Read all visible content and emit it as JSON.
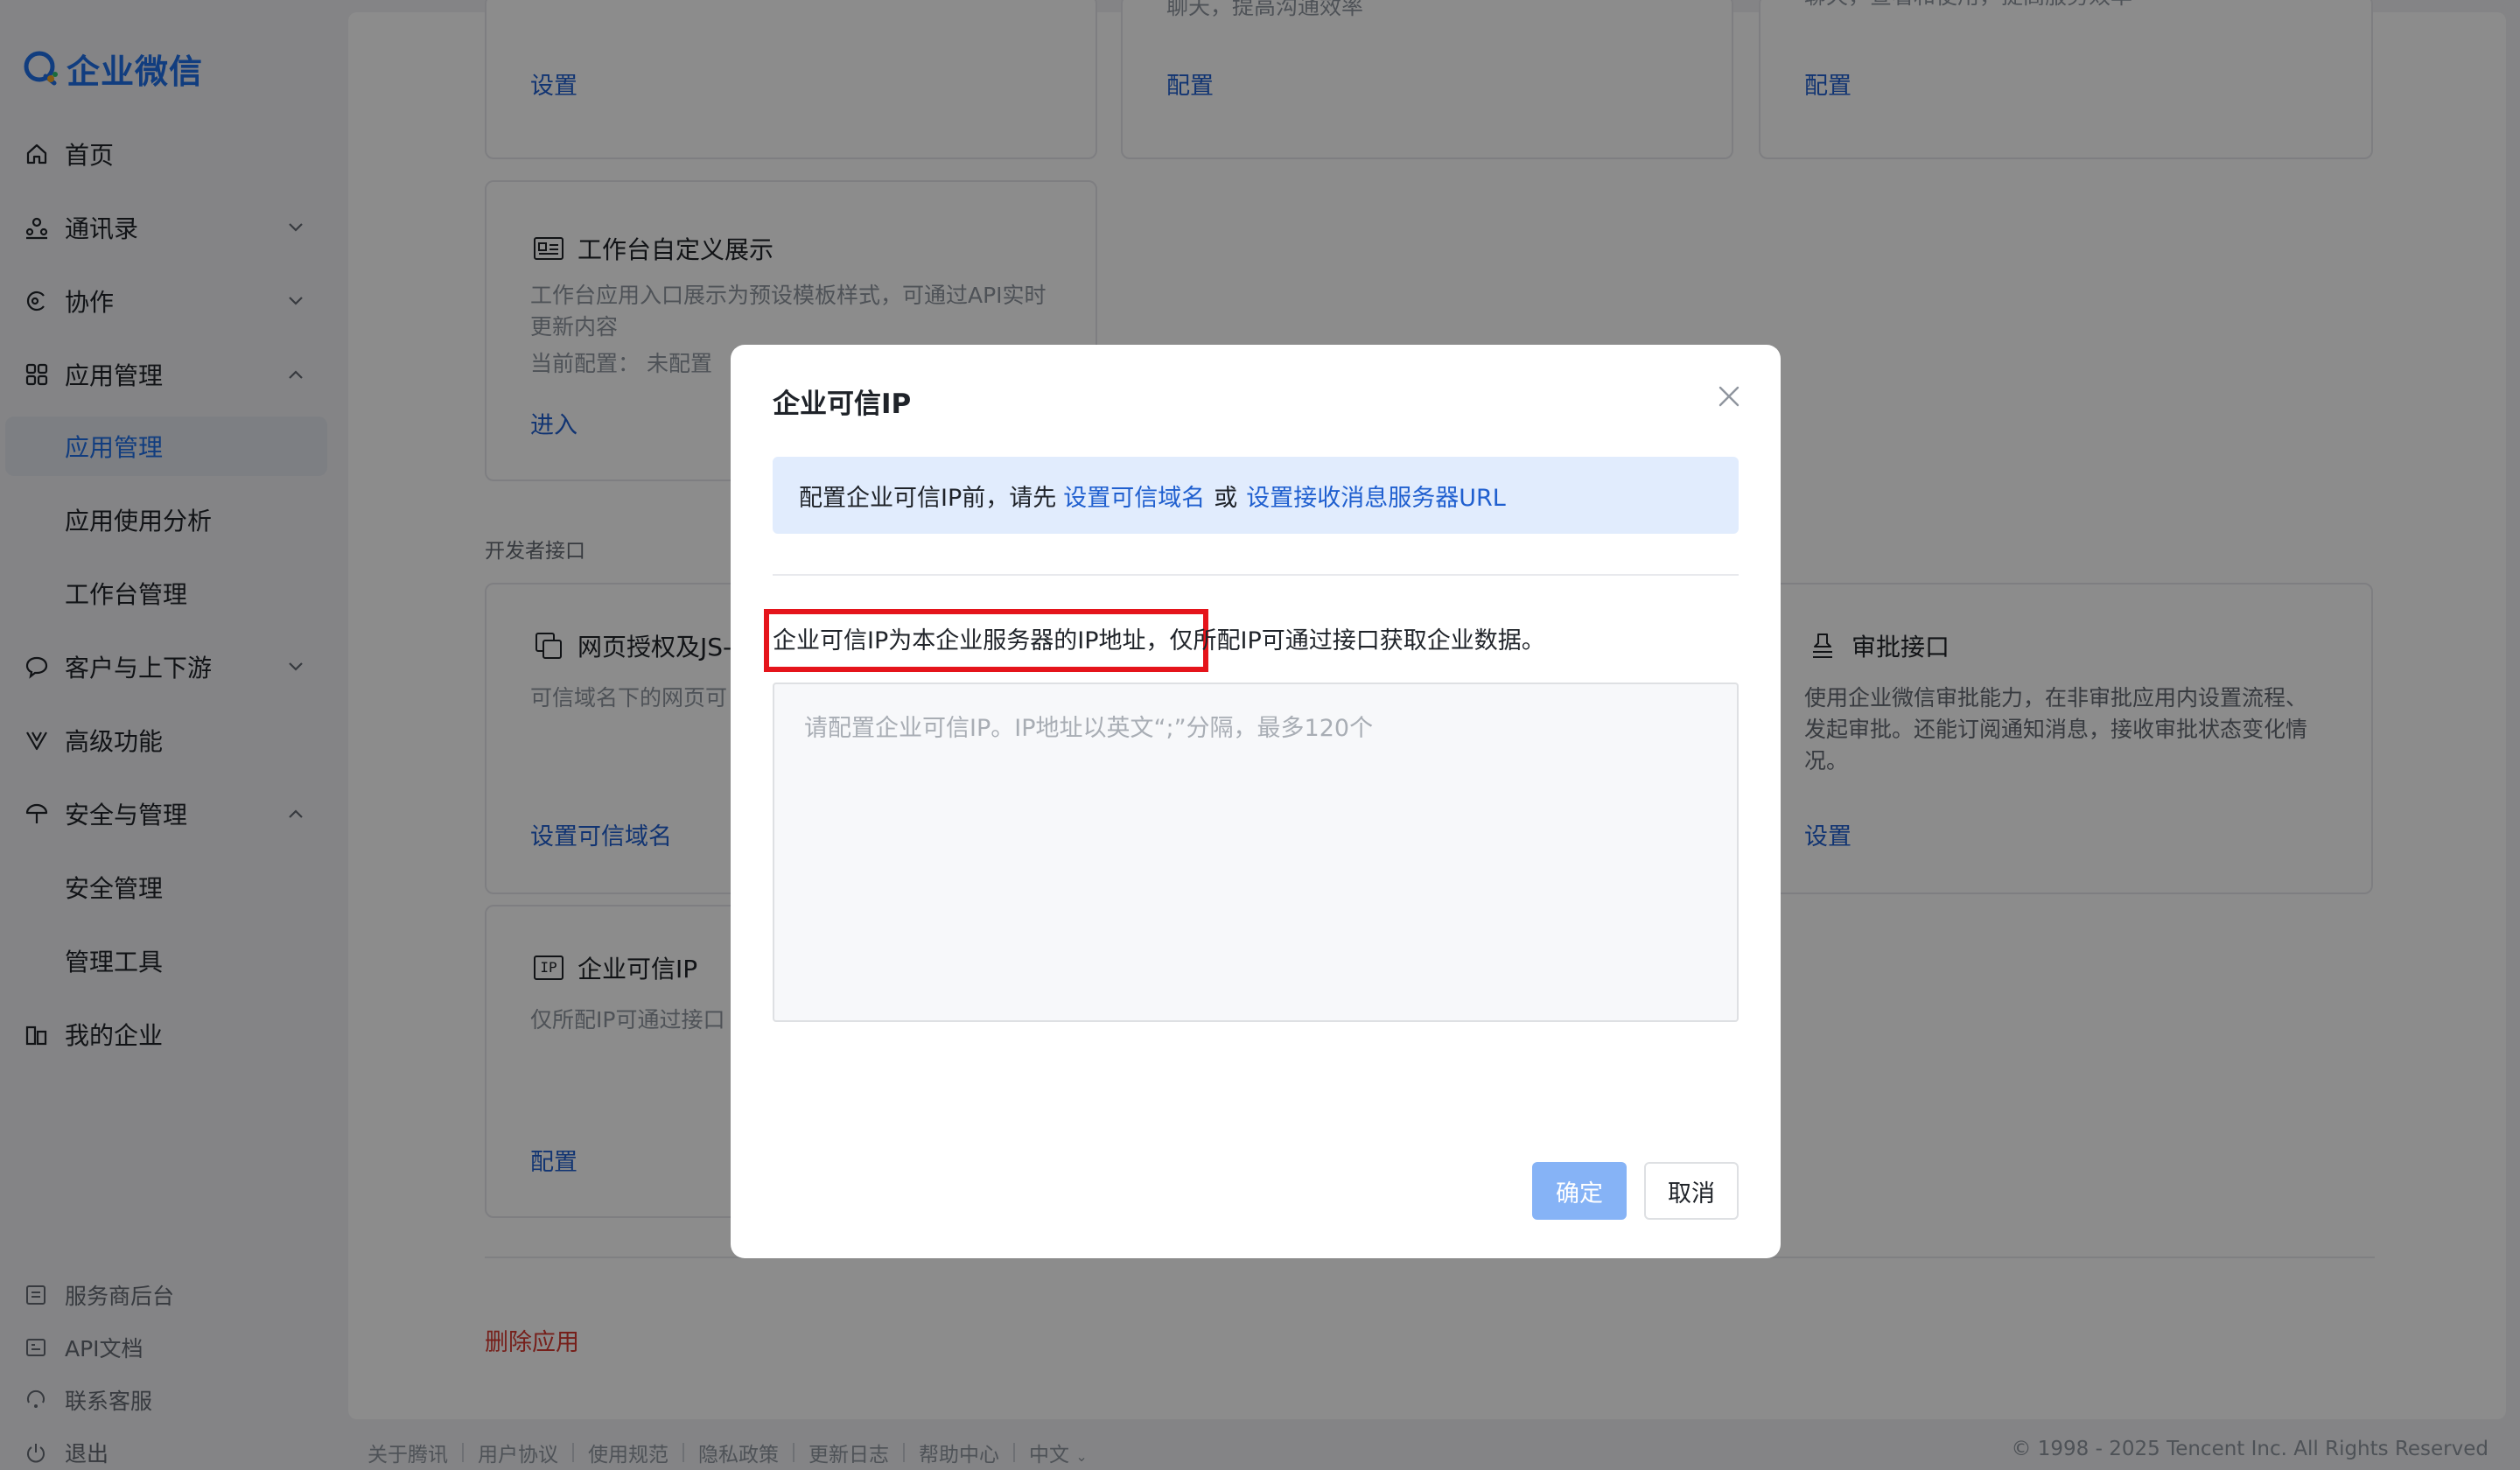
{
  "brand": {
    "name": "企业微信",
    "accent": "#1f6fe8"
  },
  "sidebar": {
    "items": [
      {
        "label": "首页",
        "icon": "home-icon"
      },
      {
        "label": "通讯录",
        "icon": "org-chart-icon"
      },
      {
        "label": "协作",
        "icon": "collaboration-icon"
      },
      {
        "label": "应用管理",
        "icon": "apps-grid-icon"
      },
      {
        "label": "应用管理"
      },
      {
        "label": "应用使用分析"
      },
      {
        "label": "工作台管理"
      },
      {
        "label": "客户与上下游",
        "icon": "chat-bubble-icon"
      },
      {
        "label": "高级功能",
        "icon": "advanced-icon"
      },
      {
        "label": "安全与管理",
        "icon": "umbrella-icon"
      },
      {
        "label": "安全管理"
      },
      {
        "label": "管理工具"
      },
      {
        "label": "我的企业",
        "icon": "building-icon"
      }
    ],
    "footer": [
      {
        "label": "服务商后台",
        "icon": "service-icon"
      },
      {
        "label": "API文档",
        "icon": "api-doc-icon"
      },
      {
        "label": "联系客服",
        "icon": "support-icon"
      },
      {
        "label": "退出",
        "icon": "power-icon"
      }
    ]
  },
  "main": {
    "top_cards": [
      {
        "link": "设置",
        "partial": ""
      },
      {
        "link": "配置",
        "partial": "聊天，提高沟通效率"
      },
      {
        "link": "配置",
        "partial": "聊天，查看和使用，提高服务效率"
      }
    ],
    "workbench_card": {
      "title": "工作台自定义展示",
      "desc": "工作台应用入口展示为预设模板样式，可通过API实时更新内容",
      "status": "当前配置：  未配置",
      "link": "进入"
    },
    "section_label": "开发者接口",
    "web_auth_card": {
      "title": "网页授权及JS-SDK",
      "desc": "可信域名下的网页可",
      "link": "设置可信域名"
    },
    "approval_card": {
      "title": "审批接口",
      "desc": "使用企业微信审批能力，在非审批应用内设置流程、发起审批。还能订阅通知消息，接收审批状态变化情况。",
      "link": "设置"
    },
    "trusted_ip_card": {
      "title": "企业可信IP",
      "icon_text": "IP",
      "desc": "仅所配IP可通过接口",
      "link": "配置"
    },
    "delete_link": "删除应用"
  },
  "footer": {
    "links": [
      "关于腾讯",
      "用户协议",
      "使用规范",
      "隐私政策",
      "更新日志",
      "帮助中心",
      "中文"
    ],
    "copyright": "© 1998 - 2025 Tencent Inc. All Rights Reserved"
  },
  "modal": {
    "title": "企业可信IP",
    "notice_prefix": "配置企业可信IP前，请先",
    "notice_link1": "设置可信域名",
    "notice_or": "或",
    "notice_link2": "设置接收消息服务器URL",
    "description": "企业可信IP为本企业服务器的IP地址，仅所配IP可通过接口获取企业数据。",
    "input_value": "",
    "input_placeholder": "请配置企业可信IP。IP地址以英文“;”分隔，最多120个",
    "confirm_label": "确定",
    "cancel_label": "取消"
  },
  "colors": {
    "link": "#1f5fcf",
    "danger": "#d83931",
    "highlight_border": "#e5141b",
    "notice_bg": "#e1ecfd",
    "confirm_disabled": "#86b3f6"
  }
}
